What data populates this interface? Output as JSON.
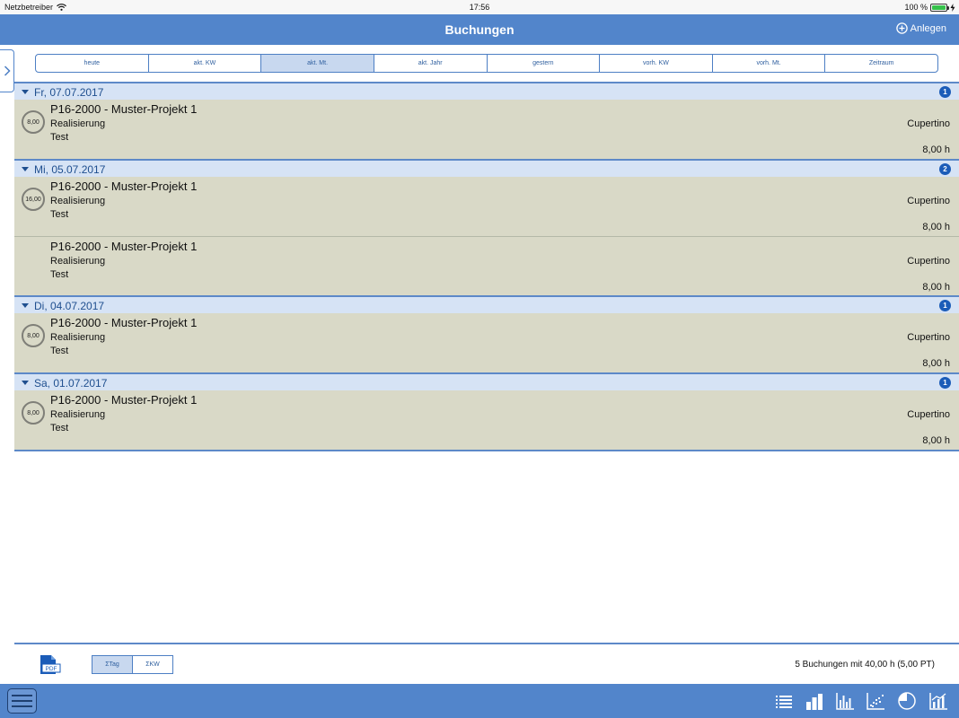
{
  "status_bar": {
    "carrier": "Netzbetreiber",
    "time": "17:56",
    "battery": "100 %"
  },
  "nav": {
    "title": "Buchungen",
    "add_label": "Anlegen"
  },
  "filters": [
    {
      "label": "heute",
      "active": false
    },
    {
      "label": "akt. KW",
      "active": false
    },
    {
      "label": "akt. Mt.",
      "active": true
    },
    {
      "label": "akt. Jahr",
      "active": false
    },
    {
      "label": "gestern",
      "active": false
    },
    {
      "label": "vorh. KW",
      "active": false
    },
    {
      "label": "vorh. Mt.",
      "active": false
    },
    {
      "label": "Zeitraum",
      "active": false
    }
  ],
  "groups": [
    {
      "date": "Fr, 07.07.2017",
      "count": "1",
      "total": "8,00",
      "entries": [
        {
          "project": "P16-2000 - Muster-Projekt 1",
          "phase": "Realisierung",
          "note": "Test",
          "location": "Cupertino",
          "hours": "8,00 h"
        }
      ]
    },
    {
      "date": "Mi, 05.07.2017",
      "count": "2",
      "total": "16,00",
      "entries": [
        {
          "project": "P16-2000 - Muster-Projekt 1",
          "phase": "Realisierung",
          "note": "Test",
          "location": "Cupertino",
          "hours": "8,00 h"
        },
        {
          "project": "P16-2000 - Muster-Projekt 1",
          "phase": "Realisierung",
          "note": "Test",
          "location": "Cupertino",
          "hours": "8,00 h"
        }
      ]
    },
    {
      "date": "Di, 04.07.2017",
      "count": "1",
      "total": "8,00",
      "entries": [
        {
          "project": "P16-2000 - Muster-Projekt 1",
          "phase": "Realisierung",
          "note": "Test",
          "location": "Cupertino",
          "hours": "8,00 h"
        }
      ]
    },
    {
      "date": "Sa, 01.07.2017",
      "count": "1",
      "total": "8,00",
      "entries": [
        {
          "project": "P16-2000 - Muster-Projekt 1",
          "phase": "Realisierung",
          "note": "Test",
          "location": "Cupertino",
          "hours": "8,00 h"
        }
      ]
    }
  ],
  "toolbar": {
    "pdf_label": "PDF",
    "sum_day": "ΣTag",
    "sum_week": "ΣKW",
    "summary": "5 Buchungen mit 40,00 h (5,00 PT)"
  },
  "tabbar": {
    "icons": [
      "list-icon",
      "bar-chart-icon",
      "column-chart-icon",
      "scatter-chart-icon",
      "pie-chart-icon",
      "combo-chart-icon"
    ]
  },
  "colors": {
    "accent": "#5285cb",
    "header_bg": "#d6e3f5",
    "entry_bg": "#d9d9c7",
    "badge": "#1b5cb8"
  }
}
